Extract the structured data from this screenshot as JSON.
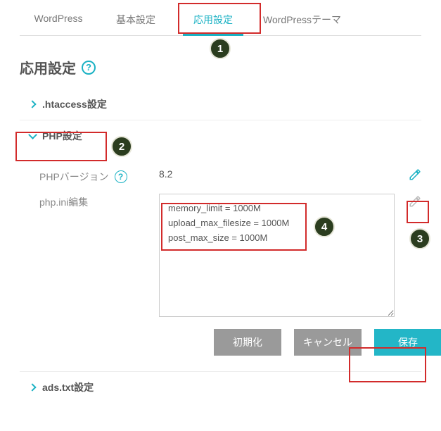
{
  "tabs": [
    {
      "label": "WordPress"
    },
    {
      "label": "基本設定"
    },
    {
      "label": "応用設定"
    },
    {
      "label": "WordPressテーマ"
    }
  ],
  "page_title": "応用設定",
  "sections": {
    "htaccess": {
      "title": ".htaccess設定"
    },
    "php": {
      "title": "PHP設定",
      "version_label": "PHPバージョン",
      "version_value": "8.2",
      "ini_label": "php.ini編集",
      "ini_value": "memory_limit = 1000M\nupload_max_filesize = 1000M\npost_max_size = 1000M"
    },
    "adstxt": {
      "title": "ads.txt設定"
    }
  },
  "buttons": {
    "reset": "初期化",
    "cancel": "キャンセル",
    "save": "保存"
  },
  "annotations": {
    "n1": "1",
    "n2": "2",
    "n3": "3",
    "n4": "4"
  }
}
